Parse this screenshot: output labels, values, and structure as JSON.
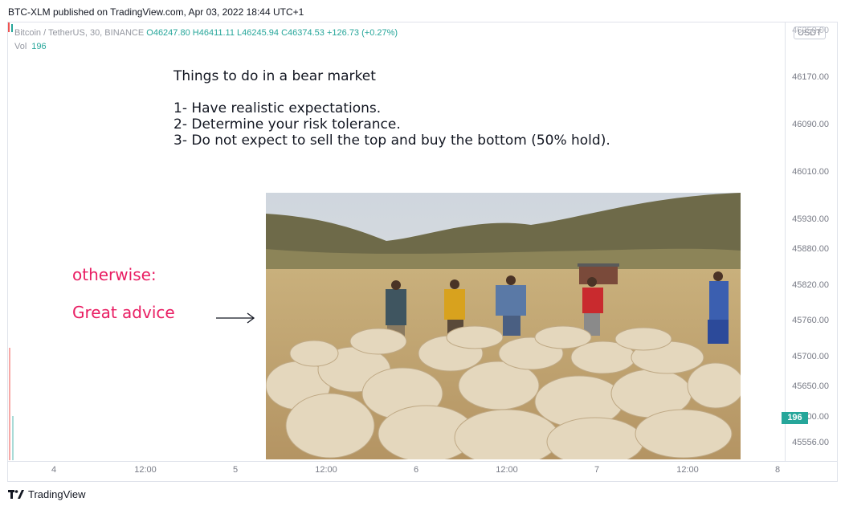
{
  "header": {
    "publish_line": "BTC-XLM published on TradingView.com, Apr 03, 2022 18:44 UTC+1"
  },
  "legend": {
    "symbol": "Bitcoin / TetherUS, 30, BINANCE",
    "open": "O46247.80",
    "high": "H46411.11",
    "low": "L46245.94",
    "close": "C46374.53",
    "change": "+126.73 (+0.27%)",
    "vol_label": "Vol",
    "vol_value": "196"
  },
  "price_axis": {
    "currency": "USDT",
    "ticks": [
      "46250.00",
      "46170.00",
      "46090.00",
      "46010.00",
      "45930.00",
      "45880.00",
      "45820.00",
      "45760.00",
      "45700.00",
      "45650.00",
      "45600.00",
      "45556.00"
    ],
    "volume_label": "196"
  },
  "time_axis": {
    "ticks": [
      "4",
      "12:00",
      "5",
      "12:00",
      "6",
      "12:00",
      "7",
      "12:00",
      "8"
    ]
  },
  "note": {
    "title": "Things to do in a bear market",
    "items": [
      "1- Have realistic expectations.",
      "2- Determine your risk tolerance.",
      "3- Do not expect to sell the top and buy the bottom (50% hold)."
    ]
  },
  "annotation": {
    "otherwise": "otherwise:",
    "advice": "Great advice"
  },
  "footer": {
    "brand": "TradingView"
  },
  "colors": {
    "up": "#26a69a",
    "down": "#ef5350",
    "pink": "#e91e63",
    "axis_text": "#787b86"
  }
}
